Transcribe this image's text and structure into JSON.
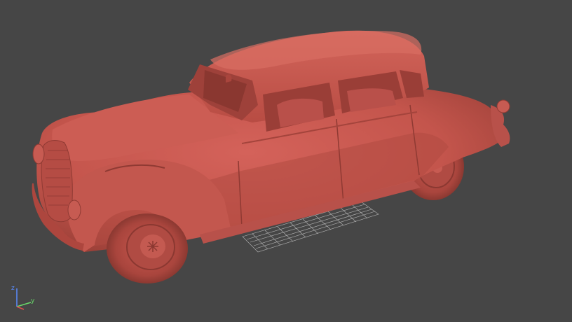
{
  "viewport": {
    "background": "#464646",
    "model": {
      "subject": "vintage-sedan-3d-model",
      "material_color": "#c4554c",
      "shadow_color": "#8f3a33",
      "highlight_color": "#d9685d"
    },
    "grid": {
      "color": "#c9c9c9"
    },
    "axis_gizmo": {
      "z_label": "z",
      "y_label": "y",
      "z_color": "#5a8cff",
      "y_color": "#68d96a",
      "x_color": "#e05050"
    }
  }
}
